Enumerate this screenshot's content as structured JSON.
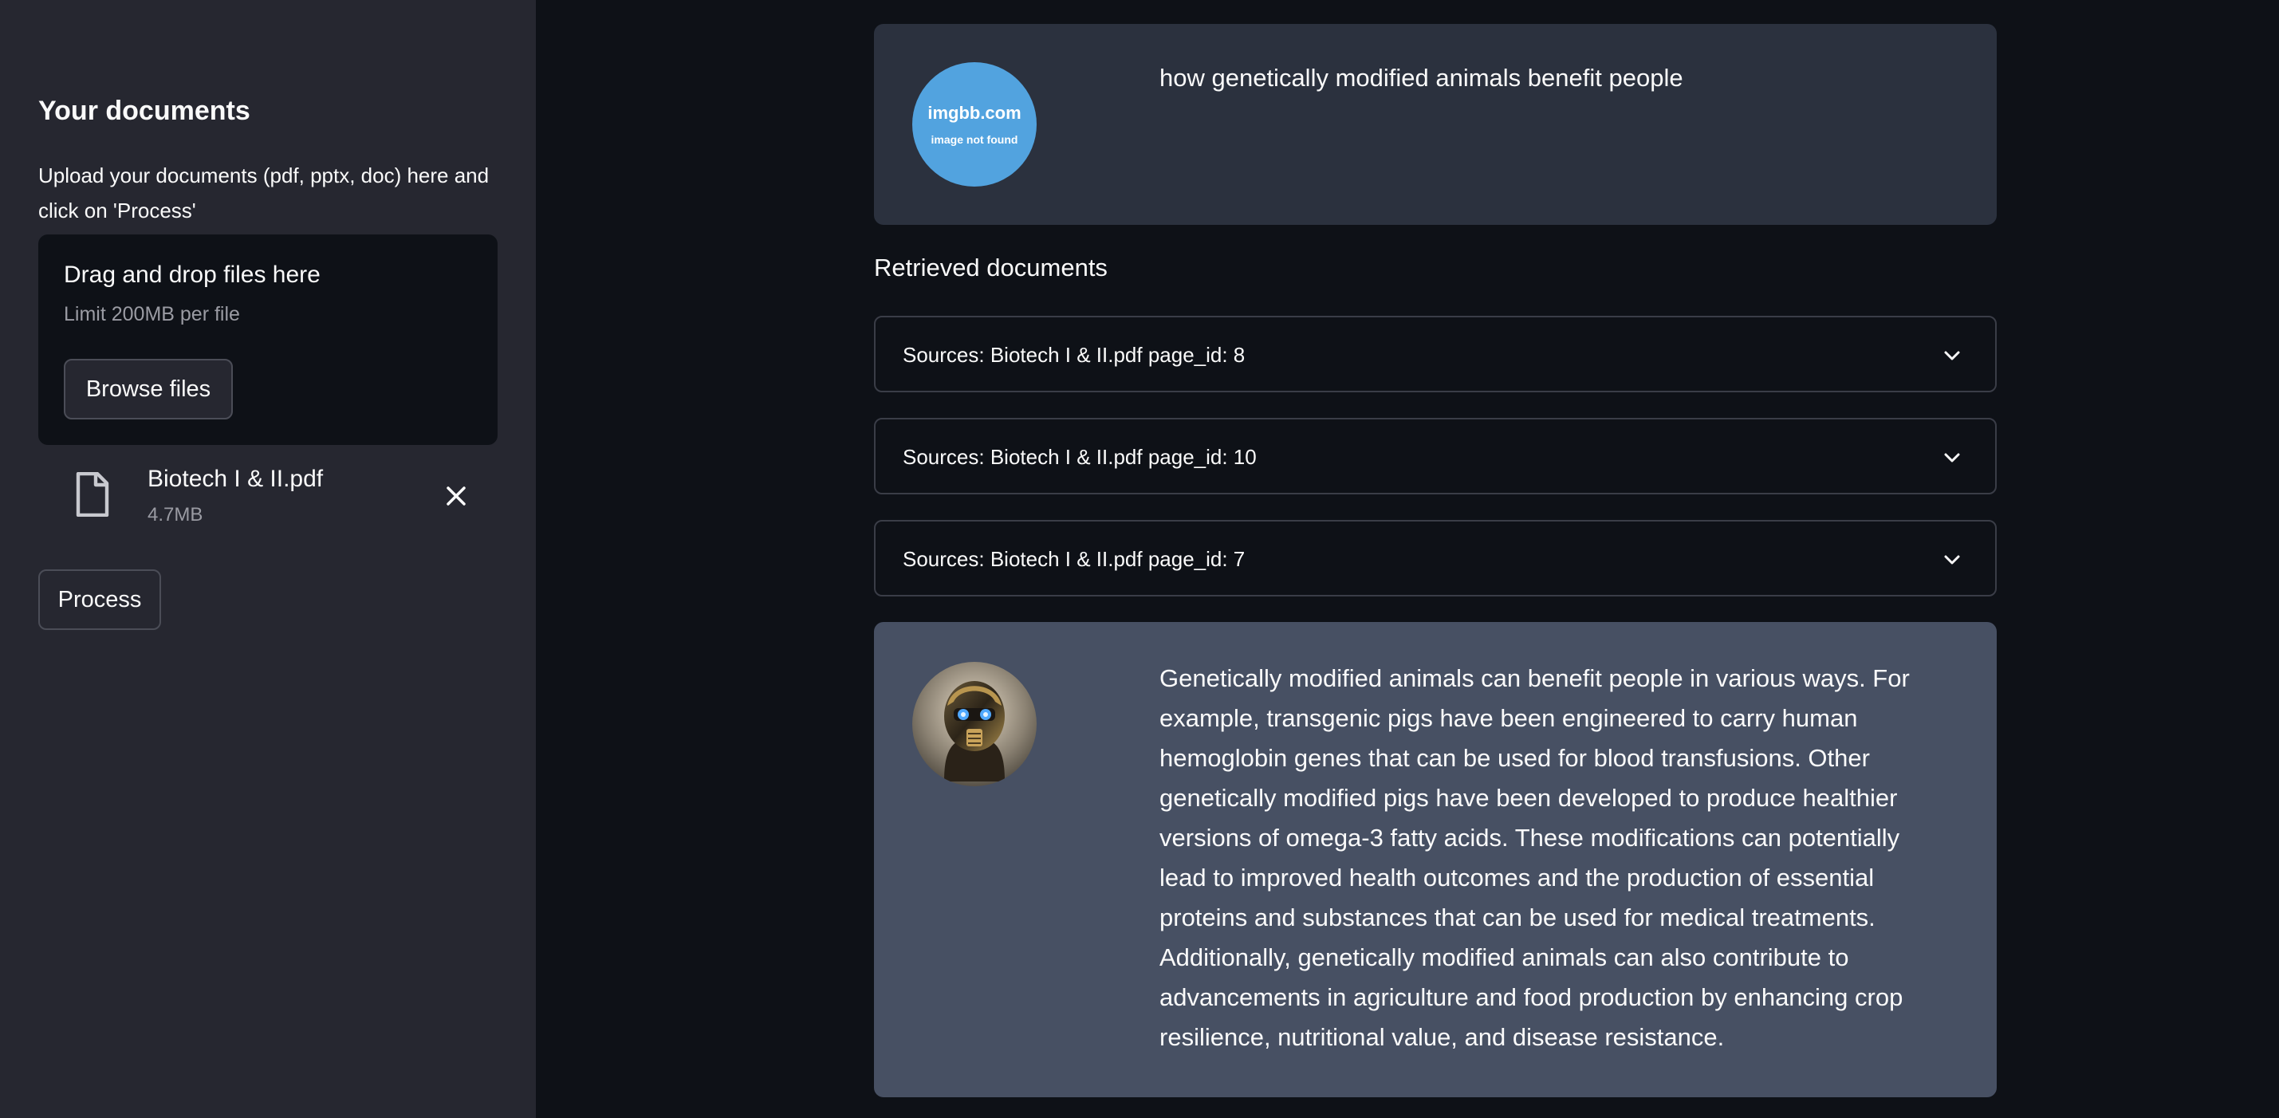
{
  "sidebar": {
    "title": "Your documents",
    "description": "Upload your documents (pdf, pptx, doc) here and click on 'Process'",
    "uploader": {
      "drop_label": "Drag and drop files here",
      "limit_label": "Limit 200MB per file",
      "browse_label": "Browse files"
    },
    "file": {
      "name": "Biotech I & II.pdf",
      "size": "4.7MB",
      "icon": "file-icon"
    },
    "process_label": "Process"
  },
  "chat": {
    "user_avatar": {
      "title": "imgbb.com",
      "subtitle": "image not found",
      "color": "#52a3df"
    },
    "user_message": "how genetically modified animals benefit people",
    "retrieved_title": "Retrieved documents",
    "sources": [
      {
        "label": "Sources: Biotech I & II.pdf page_id: 8"
      },
      {
        "label": "Sources: Biotech I & II.pdf page_id: 10"
      },
      {
        "label": "Sources: Biotech I & II.pdf page_id: 7"
      }
    ],
    "bot_message": "Genetically modified animals can benefit people in various ways. For example, transgenic pigs have been engineered to carry human hemoglobin genes that can be used for blood transfusions. Other genetically modified pigs have been developed to produce healthier versions of omega-3 fatty acids. These modifications can potentially lead to improved health outcomes and the production of essential proteins and substances that can be used for medical treatments. Additionally, genetically modified animals can also contribute to advancements in agriculture and food production by enhancing crop resilience, nutritional value, and disease resistance."
  },
  "colors": {
    "app_background": "#0e1117",
    "sidebar_background": "#262730",
    "user_box_background": "#2b313e",
    "bot_box_background": "#475063"
  }
}
